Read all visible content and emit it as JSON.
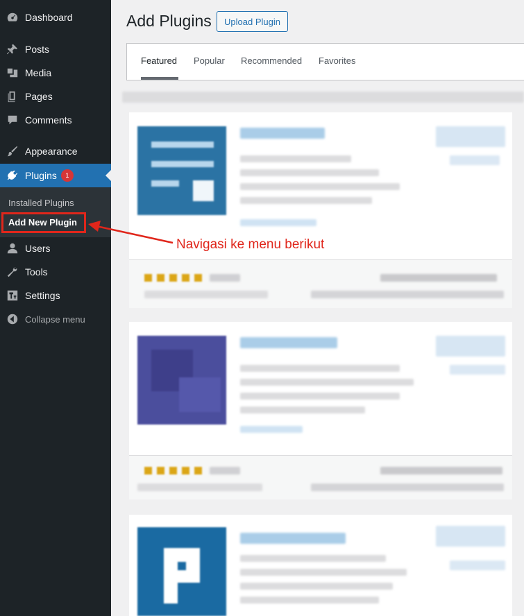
{
  "sidebar": {
    "items": [
      {
        "label": "Dashboard",
        "icon": "dashboard-icon"
      },
      {
        "label": "Posts",
        "icon": "pin-icon"
      },
      {
        "label": "Media",
        "icon": "media-icon"
      },
      {
        "label": "Pages",
        "icon": "pages-icon"
      },
      {
        "label": "Comments",
        "icon": "comment-icon"
      },
      {
        "label": "Appearance",
        "icon": "brush-icon"
      },
      {
        "label": "Plugins",
        "icon": "plugin-icon",
        "badge": "1"
      },
      {
        "label": "Users",
        "icon": "users-icon"
      },
      {
        "label": "Tools",
        "icon": "wrench-icon"
      },
      {
        "label": "Settings",
        "icon": "settings-icon"
      },
      {
        "label": "Collapse menu",
        "icon": "collapse-icon"
      }
    ],
    "submenu": {
      "installed": "Installed Plugins",
      "add_new": "Add New Plugin"
    }
  },
  "header": {
    "title": "Add Plugins",
    "upload_label": "Upload Plugin"
  },
  "tabs": [
    {
      "label": "Featured",
      "active": true
    },
    {
      "label": "Popular"
    },
    {
      "label": "Recommended"
    },
    {
      "label": "Favorites"
    }
  ],
  "annotation": {
    "text": "Navigasi ke menu berikut",
    "color": "#e0261b"
  },
  "colors": {
    "sidebar_bg": "#1d2327",
    "accent": "#2271b1",
    "badge": "#d63638"
  }
}
